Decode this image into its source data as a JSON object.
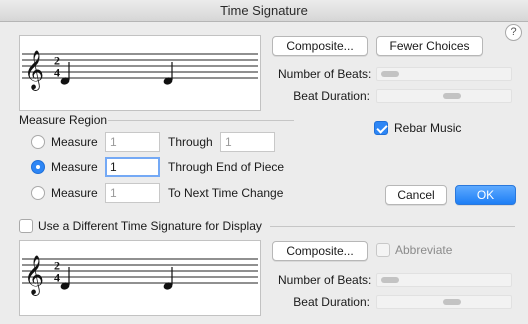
{
  "window": {
    "title": "Time Signature"
  },
  "help": {
    "glyph": "?"
  },
  "top": {
    "composite_label": "Composite...",
    "fewer_choices_label": "Fewer Choices",
    "beats_label": "Number of Beats:",
    "duration_label": "Beat Duration:",
    "time_signature": {
      "numerator": "2",
      "denominator": "4"
    }
  },
  "measure_region": {
    "heading": "Measure Region",
    "rows": [
      {
        "label": "Measure",
        "value": "1",
        "through_label": "Through",
        "through_value": "1",
        "selected": false
      },
      {
        "label": "Measure",
        "value": "1",
        "through_label": "Through End of Piece",
        "selected": true
      },
      {
        "label": "Measure",
        "value": "1",
        "through_label": "To Next Time Change",
        "selected": false
      }
    ]
  },
  "rebar": {
    "label": "Rebar Music",
    "checked": true
  },
  "actions": {
    "cancel_label": "Cancel",
    "ok_label": "OK"
  },
  "display": {
    "checkbox_label": "Use a Different Time Signature for Display",
    "checked": false,
    "composite_label": "Composite...",
    "abbreviate_label": "Abbreviate",
    "beats_label": "Number of Beats:",
    "duration_label": "Beat Duration:",
    "time_signature": {
      "numerator": "2",
      "denominator": "4"
    }
  },
  "colors": {
    "accent": "#2d86f5",
    "window_bg": "#ececec"
  }
}
